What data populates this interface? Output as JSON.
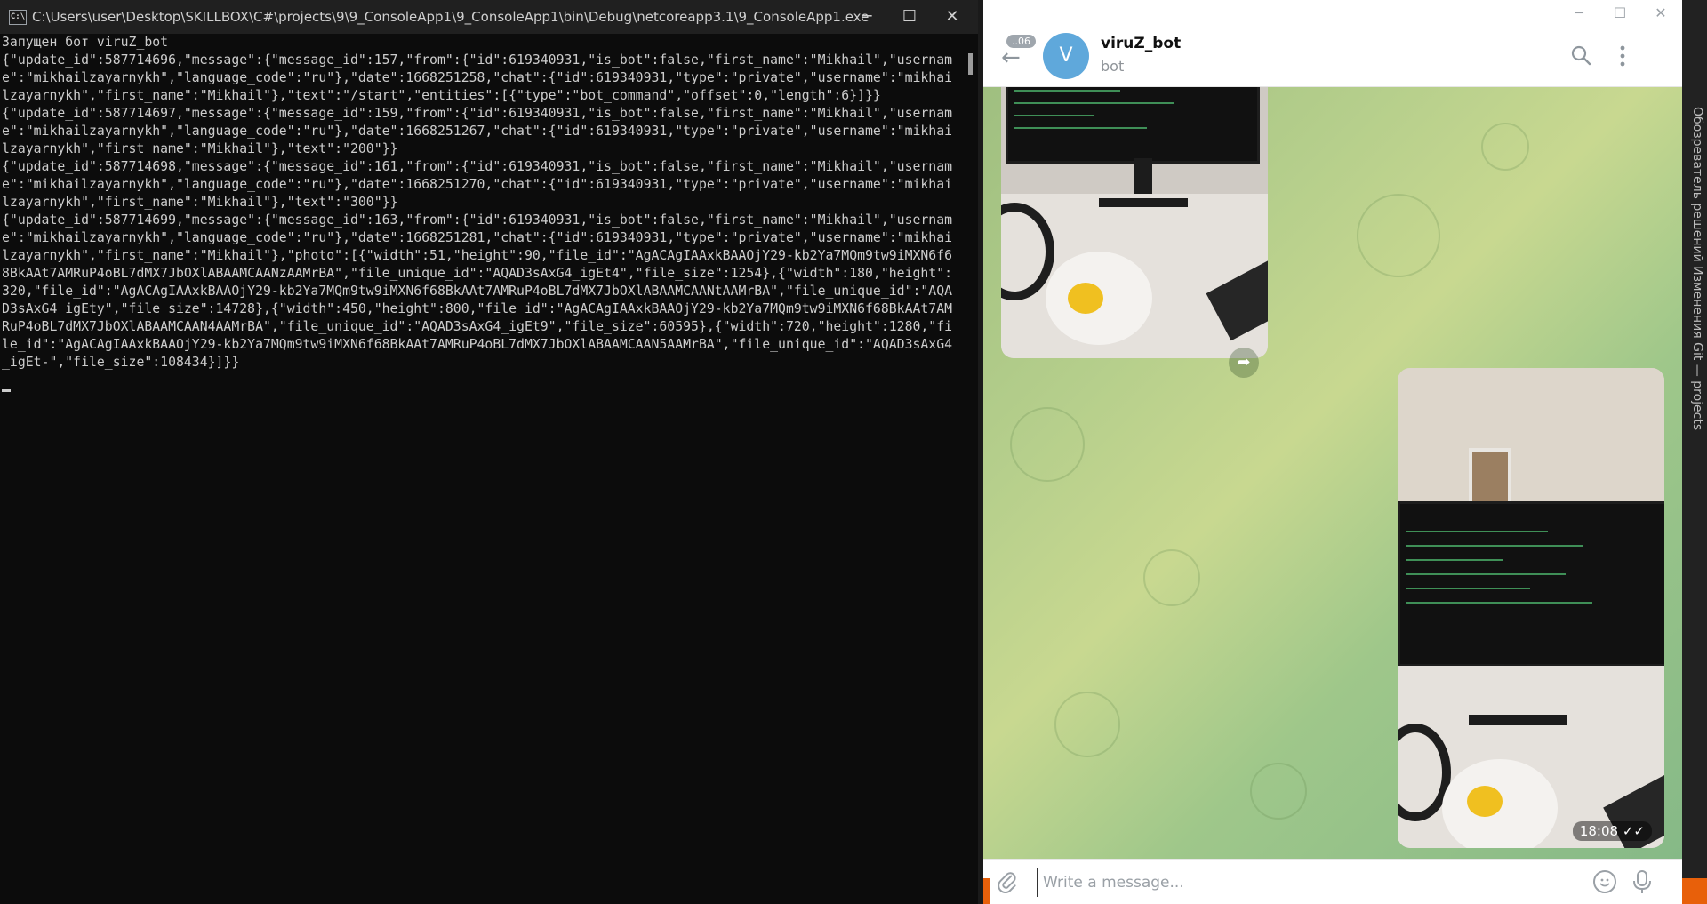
{
  "console": {
    "title": "C:\\Users\\user\\Desktop\\SKILLBOX\\C#\\projects\\9\\9_ConsoleApp1\\9_ConsoleApp1\\bin\\Debug\\netcoreapp3.1\\9_ConsoleApp1.exe",
    "icon_label": "C:\\",
    "lines": [
      "Запущен бот viruZ_bot",
      "{\"update_id\":587714696,\"message\":{\"message_id\":157,\"from\":{\"id\":619340931,\"is_bot\":false,\"first_name\":\"Mikhail\",\"usernam",
      "e\":\"mikhailzayarnykh\",\"language_code\":\"ru\"},\"date\":1668251258,\"chat\":{\"id\":619340931,\"type\":\"private\",\"username\":\"mikhai",
      "lzayarnykh\",\"first_name\":\"Mikhail\"},\"text\":\"/start\",\"entities\":[{\"type\":\"bot_command\",\"offset\":0,\"length\":6}]}}",
      "{\"update_id\":587714697,\"message\":{\"message_id\":159,\"from\":{\"id\":619340931,\"is_bot\":false,\"first_name\":\"Mikhail\",\"usernam",
      "e\":\"mikhailzayarnykh\",\"language_code\":\"ru\"},\"date\":1668251267,\"chat\":{\"id\":619340931,\"type\":\"private\",\"username\":\"mikhai",
      "lzayarnykh\",\"first_name\":\"Mikhail\"},\"text\":\"200\"}}",
      "{\"update_id\":587714698,\"message\":{\"message_id\":161,\"from\":{\"id\":619340931,\"is_bot\":false,\"first_name\":\"Mikhail\",\"usernam",
      "e\":\"mikhailzayarnykh\",\"language_code\":\"ru\"},\"date\":1668251270,\"chat\":{\"id\":619340931,\"type\":\"private\",\"username\":\"mikhai",
      "lzayarnykh\",\"first_name\":\"Mikhail\"},\"text\":\"300\"}}",
      "{\"update_id\":587714699,\"message\":{\"message_id\":163,\"from\":{\"id\":619340931,\"is_bot\":false,\"first_name\":\"Mikhail\",\"usernam",
      "e\":\"mikhailzayarnykh\",\"language_code\":\"ru\"},\"date\":1668251281,\"chat\":{\"id\":619340931,\"type\":\"private\",\"username\":\"mikhai",
      "lzayarnykh\",\"first_name\":\"Mikhail\"},\"photo\":[{\"width\":51,\"height\":90,\"file_id\":\"AgACAgIAAxkBAAOjY29-kb2Ya7MQm9tw9iMXN6f6",
      "8BkAAt7AMRuP4oBL7dMX7JbOXlABAAMCAANzAAMrBA\",\"file_unique_id\":\"AQAD3sAxG4_igEt4\",\"file_size\":1254},{\"width\":180,\"height\":",
      "320,\"file_id\":\"AgACAgIAAxkBAAOjY29-kb2Ya7MQm9tw9iMXN6f68BkAAt7AMRuP4oBL7dMX7JbOXlABAAMCAANtAAMrBA\",\"file_unique_id\":\"AQA",
      "D3sAxG4_igEty\",\"file_size\":14728},{\"width\":450,\"height\":800,\"file_id\":\"AgACAgIAAxkBAAOjY29-kb2Ya7MQm9tw9iMXN6f68BkAAt7AM",
      "RuP4oBL7dMX7JbOXlABAAMCAAN4AAMrBA\",\"file_unique_id\":\"AQAD3sAxG4_igEt9\",\"file_size\":60595},{\"width\":720,\"height\":1280,\"fi",
      "le_id\":\"AgACAgIAAxkBAAOjY29-kb2Ya7MQm9tw9iMXN6f68BkAAt7AMRuP4oBL7dMX7JbOXlABAAMCAAN5AAMrBA\",\"file_unique_id\":\"AQAD3sAxG4",
      "_igEt-\",\"file_size\":108434}]}}"
    ],
    "controls": {
      "minimize": "─",
      "maximize": "☐",
      "close": "✕"
    }
  },
  "telegram": {
    "controls": {
      "minimize": "─",
      "maximize": "☐",
      "close": "✕"
    },
    "header": {
      "unread": "..06",
      "avatar_letter": "V",
      "name": "viruZ_bot",
      "status": "bot"
    },
    "messages": [
      {
        "type": "photo",
        "direction": "incoming"
      },
      {
        "type": "photo",
        "direction": "outgoing",
        "time": "18:08",
        "read": "✓✓"
      }
    ],
    "input": {
      "placeholder": "Write a message..."
    },
    "icons": {
      "back": "back-arrow-icon",
      "search": "search-icon",
      "menu": "more-vertical-icon",
      "forward": "forward-icon",
      "attach": "paperclip-icon",
      "emoji": "emoji-icon",
      "mic": "microphone-icon"
    }
  },
  "side_panel": {
    "text": "Обозреватель решений   Изменения Git — projects"
  }
}
